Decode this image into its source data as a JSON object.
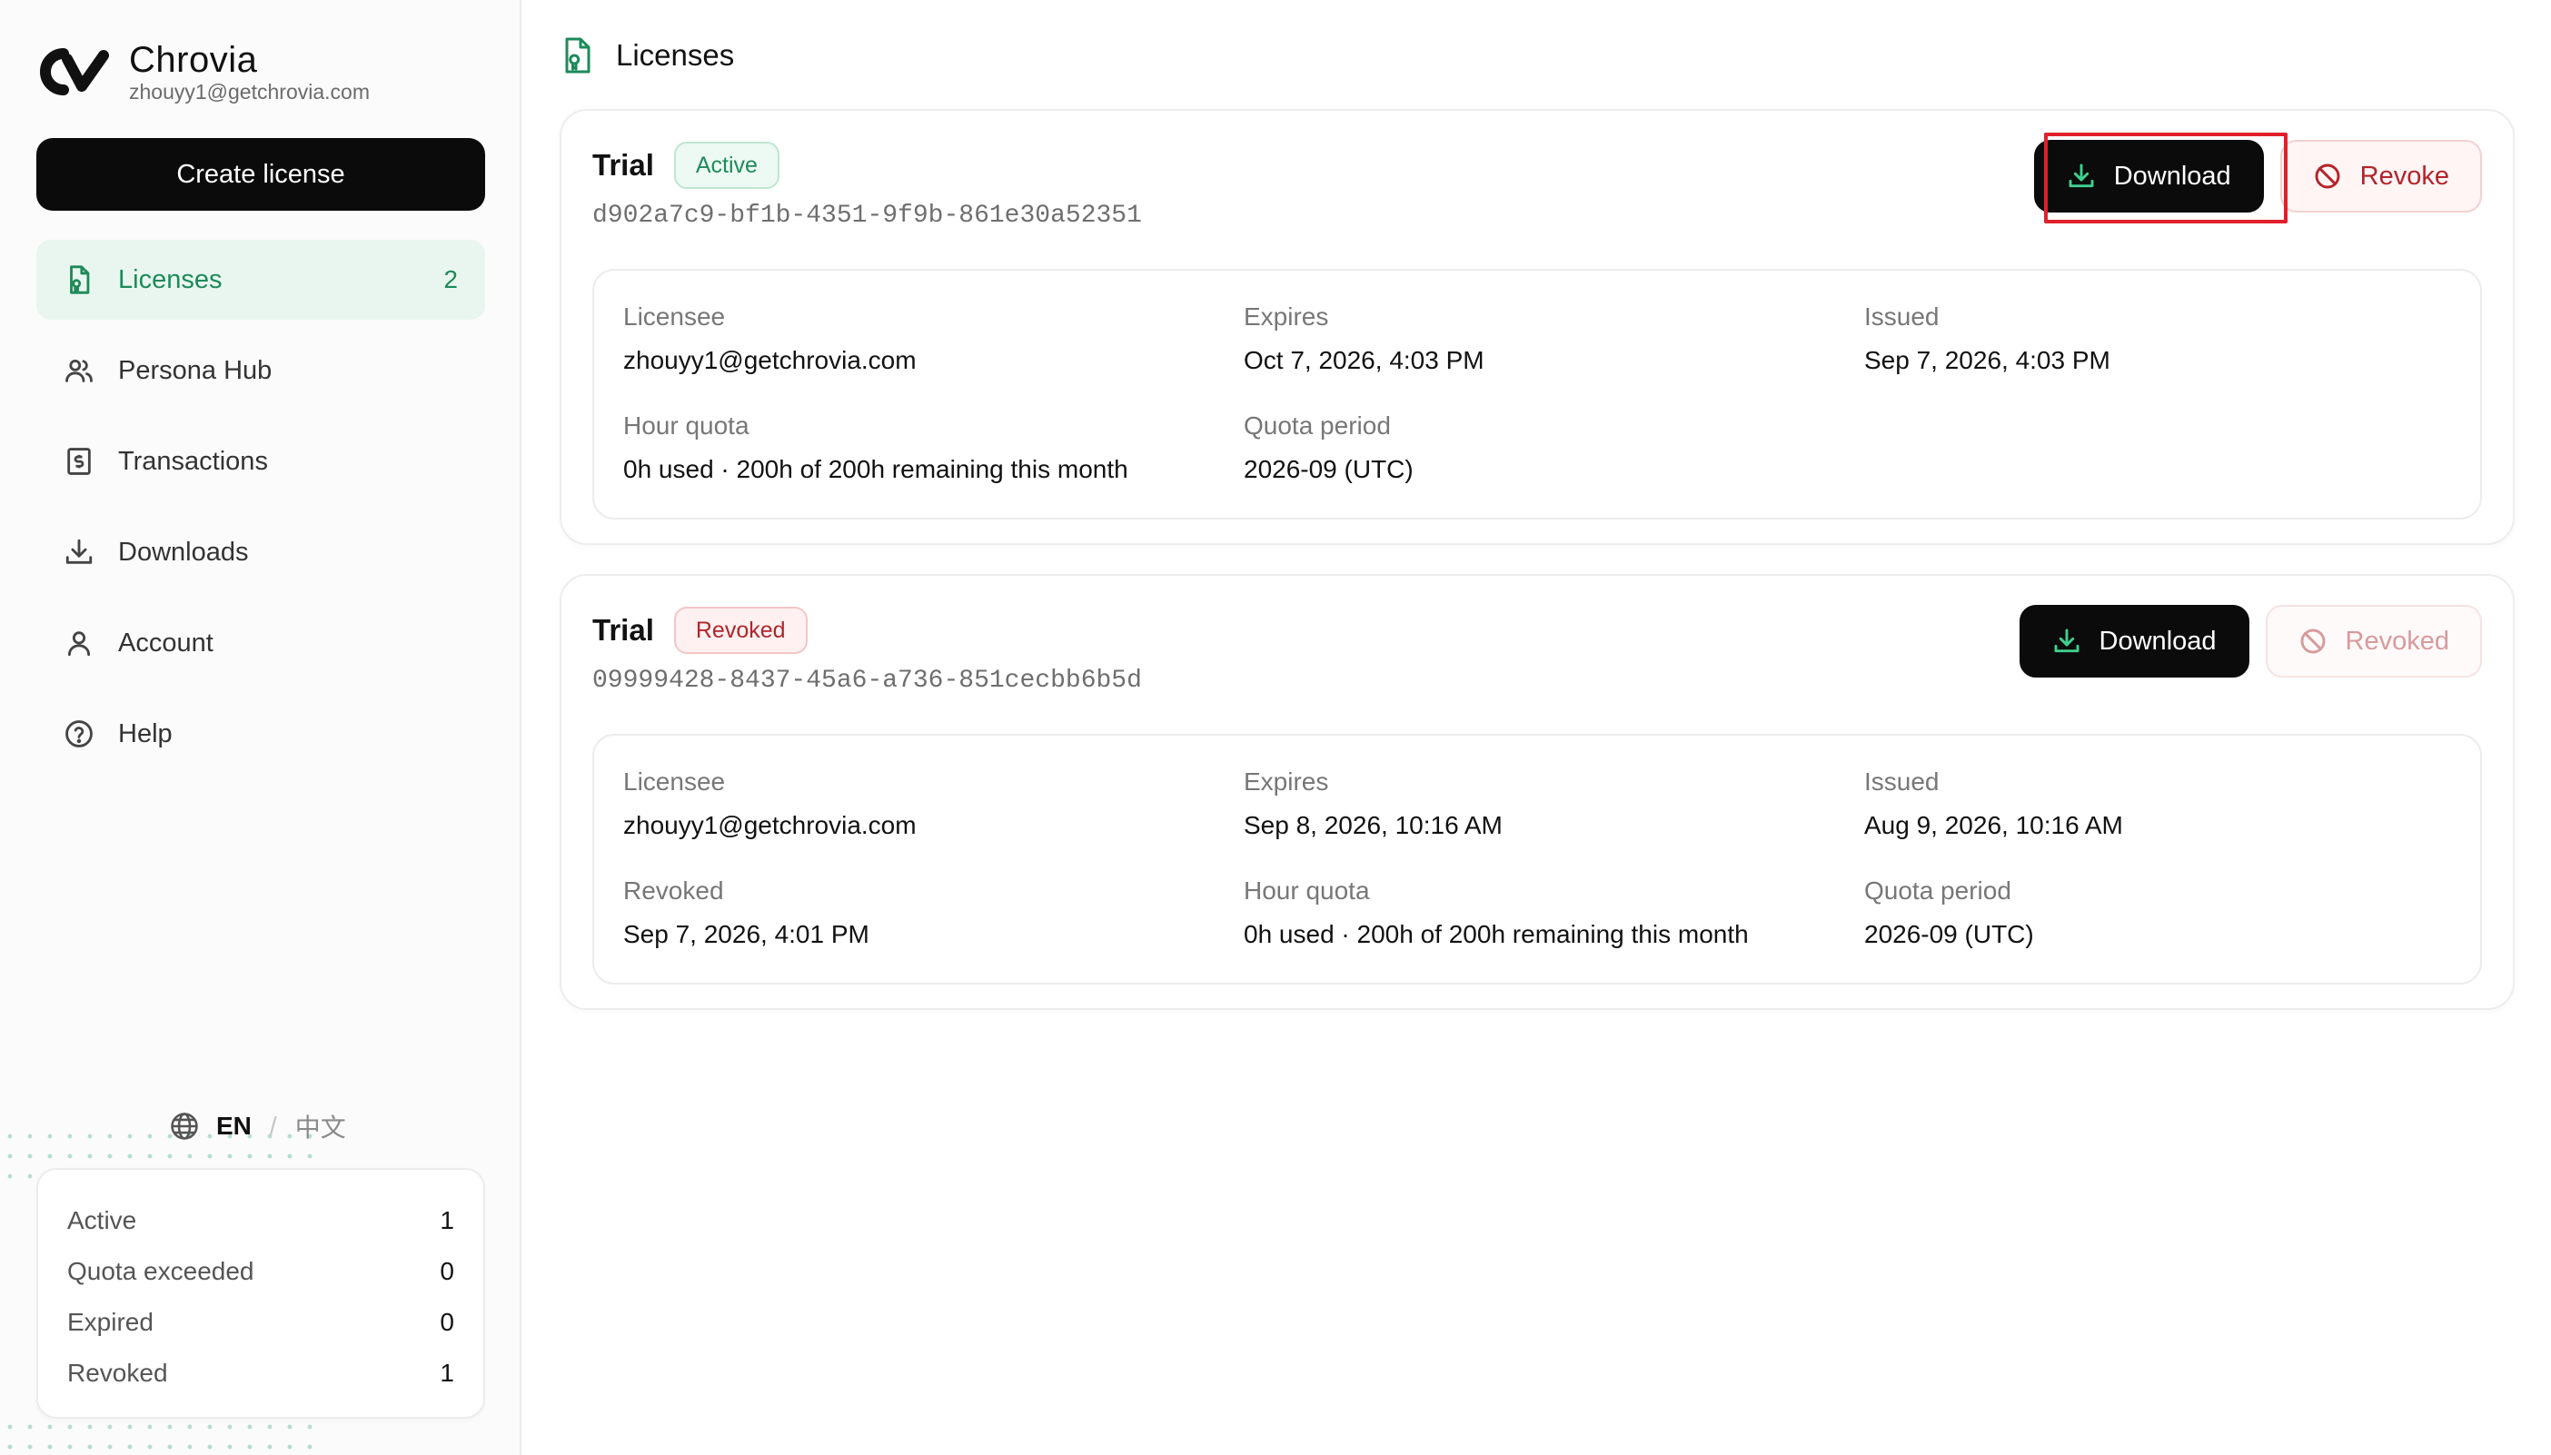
{
  "brand": {
    "name": "Chrovia",
    "email": "zhouyy1@getchrovia.com"
  },
  "sidebar": {
    "create_label": "Create license",
    "items": [
      {
        "label": "Licenses",
        "count": "2",
        "icon": "license-icon",
        "active": true
      },
      {
        "label": "Persona Hub",
        "icon": "users-icon"
      },
      {
        "label": "Transactions",
        "icon": "receipt-icon"
      },
      {
        "label": "Downloads",
        "icon": "download-icon"
      },
      {
        "label": "Account",
        "icon": "user-icon"
      },
      {
        "label": "Help",
        "icon": "help-icon"
      }
    ],
    "lang": {
      "en": "EN",
      "sep": "/",
      "zh": "中文"
    },
    "stats": [
      {
        "label": "Active",
        "value": "1"
      },
      {
        "label": "Quota exceeded",
        "value": "0"
      },
      {
        "label": "Expired",
        "value": "0"
      },
      {
        "label": "Revoked",
        "value": "1"
      }
    ]
  },
  "main": {
    "title": "Licenses",
    "cards": [
      {
        "type": "Trial",
        "status": "Active",
        "id": "d902a7c9-bf1b-4351-9f9b-861e30a52351",
        "download_label": "Download",
        "secondary_label": "Revoke",
        "fields": [
          {
            "label": "Licensee",
            "value": "zhouyy1@getchrovia.com"
          },
          {
            "label": "Expires",
            "value": "Oct 7, 2026, 4:03 PM"
          },
          {
            "label": "Issued",
            "value": "Sep 7, 2026, 4:03 PM"
          },
          {
            "label": "Hour quota",
            "value": "0h used · 200h of 200h remaining this month"
          },
          {
            "label": "Quota period",
            "value": "2026-09 (UTC)"
          }
        ]
      },
      {
        "type": "Trial",
        "status": "Revoked",
        "id": "09999428-8437-45a6-a736-851cecbb6b5d",
        "download_label": "Download",
        "secondary_label": "Revoked",
        "fields": [
          {
            "label": "Licensee",
            "value": "zhouyy1@getchrovia.com"
          },
          {
            "label": "Expires",
            "value": "Sep 8, 2026, 10:16 AM"
          },
          {
            "label": "Issued",
            "value": "Aug 9, 2026, 10:16 AM"
          },
          {
            "label": "Revoked",
            "value": "Sep 7, 2026, 4:01 PM"
          },
          {
            "label": "Hour quota",
            "value": "0h used · 200h of 200h remaining this month"
          },
          {
            "label": "Quota period",
            "value": "2026-09 (UTC)"
          }
        ]
      }
    ]
  },
  "colors": {
    "accent": "#1d8a5a",
    "danger": "#b3242a",
    "dark": "#0b0b0b"
  }
}
